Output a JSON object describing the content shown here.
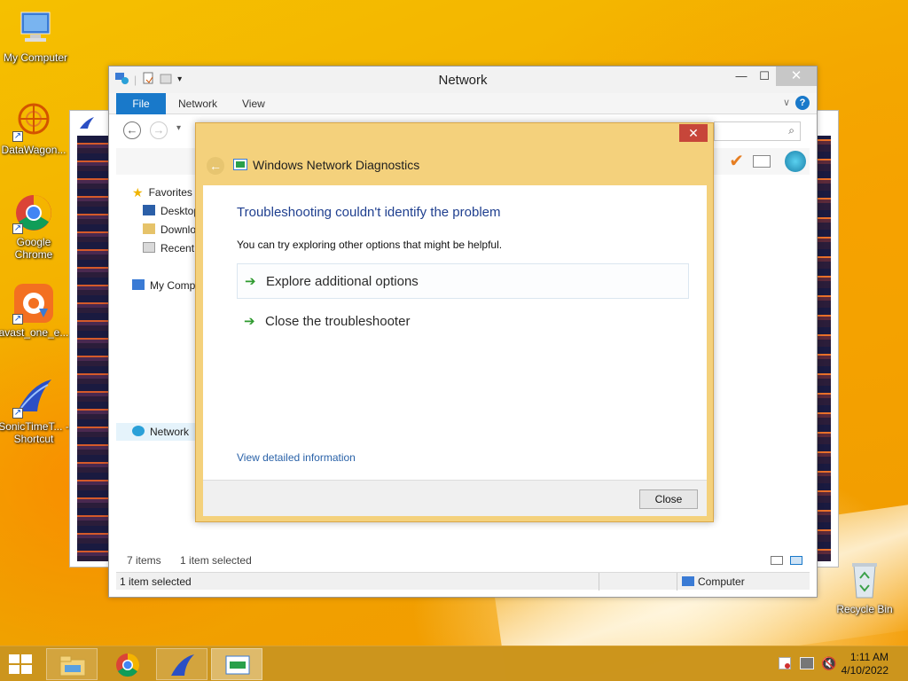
{
  "desktop": {
    "icons": [
      {
        "label": "My Computer"
      },
      {
        "label": "DataWagon..."
      },
      {
        "label": "Google Chrome"
      },
      {
        "label": "avast_one_e..."
      },
      {
        "label": "SonicTimeT... - Shortcut"
      },
      {
        "label": "Recycle Bin"
      }
    ]
  },
  "explorer": {
    "title": "Network",
    "tabs": [
      "File",
      "Network",
      "View"
    ],
    "nav": {
      "favorites": "Favorites",
      "desktop": "Desktop",
      "downloads": "Downlo",
      "recent": "Recent",
      "my_computer": "My Comp",
      "network": "Network"
    },
    "items_count": "7 items",
    "selected_count": "1 item selected",
    "status_left": "1 item selected",
    "status_right": "Computer"
  },
  "dialog": {
    "title": "Windows Network Diagnostics",
    "heading": "Troubleshooting couldn't identify the problem",
    "subtext": "You can try exploring other options that might be helpful.",
    "options": [
      "Explore additional options",
      "Close the troubleshooter"
    ],
    "detail_link": "View detailed information",
    "close_button": "Close"
  },
  "taskbar": {
    "time": "1:11 AM",
    "date": "4/10/2022"
  },
  "colors": {
    "dialog_frame": "#f4d17c",
    "file_tab": "#1979ca",
    "heading_blue": "#1f3f8f",
    "link_blue": "#2a62a8",
    "arrow_green": "#2e9a2e"
  }
}
